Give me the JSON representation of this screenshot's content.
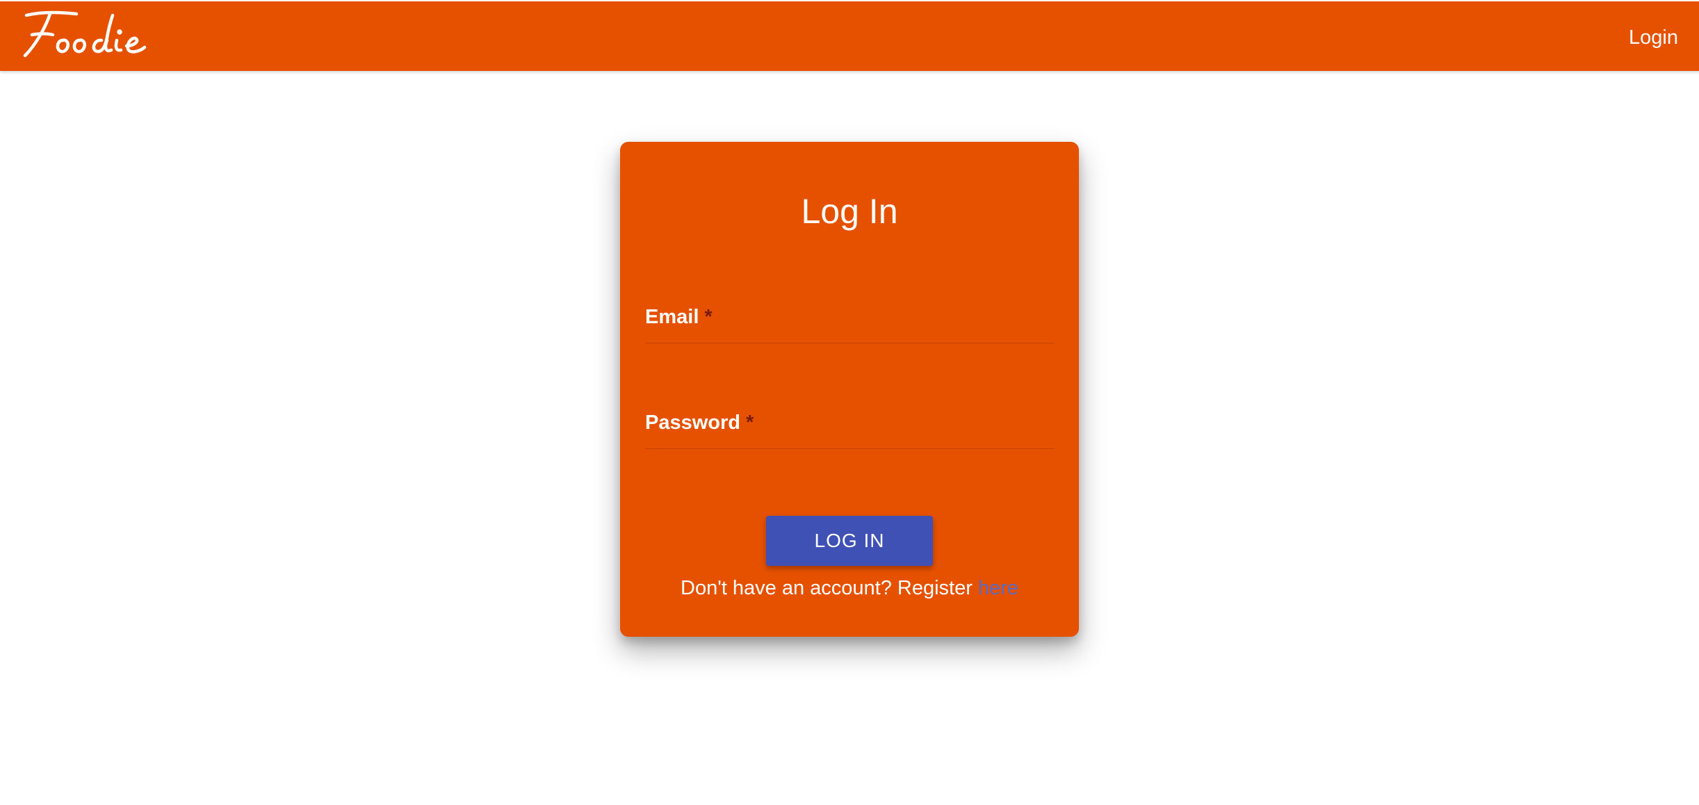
{
  "header": {
    "logo_text": "Foodie",
    "nav_login_label": "Login"
  },
  "login_card": {
    "title": "Log In",
    "email_label": "Email",
    "password_label": "Password",
    "required_marker": "*",
    "submit_label": "LOG IN",
    "register_prompt": "Don't have an account? Register",
    "register_link_label": "here"
  },
  "colors": {
    "primary": "#e65100",
    "button": "#3f51b5",
    "link": "#5c6bc0",
    "required": "#7a1b0a",
    "text_on_primary": "#ffffff"
  },
  "icons": {
    "logo": "foodie-script-logo"
  }
}
